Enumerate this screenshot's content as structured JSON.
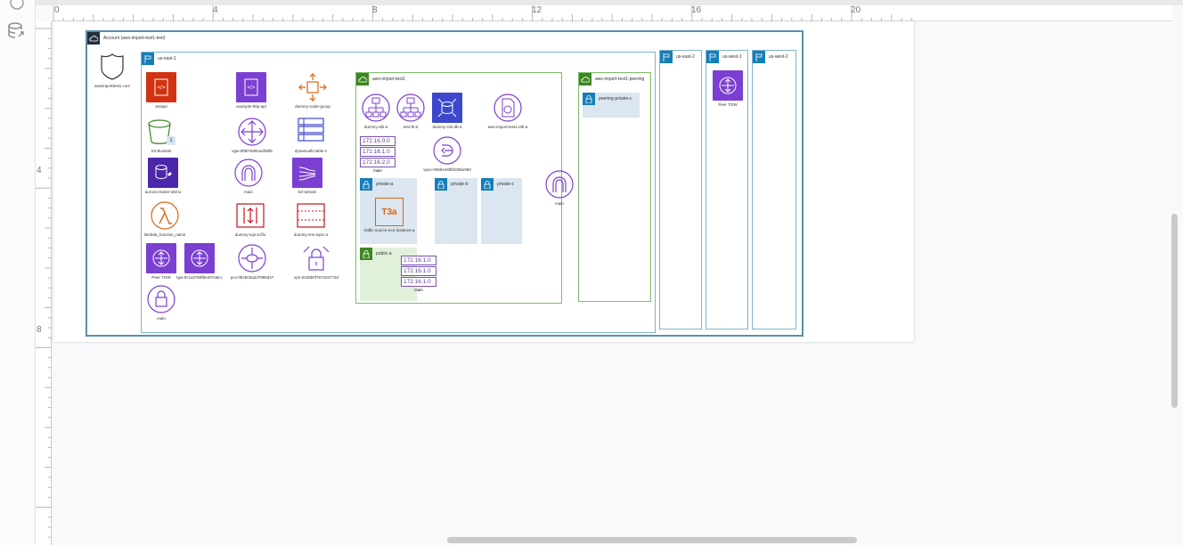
{
  "ruler": {
    "h_labels": [
      "0",
      "4",
      "8",
      "12",
      "16",
      "20"
    ],
    "v_labels": [
      "4",
      "8"
    ]
  },
  "left_toolbar": {
    "items": [
      "help-icon",
      "database-link-icon"
    ]
  },
  "account": {
    "label": "Account (aws-import-test1-test)"
  },
  "root_node": {
    "label": "awsimporttest1.com",
    "icon": "shield-icon"
  },
  "regions": {
    "main": "us-east-1",
    "r2": "us-east-2",
    "r3": "us-west-1",
    "r4": "us-west-2"
  },
  "region_nodes": {
    "apigw": "testapi",
    "http_api": "example-http-api",
    "asg": "dummy-scale-group",
    "s3": "S3 Buckets",
    "s3_badge": "1",
    "vgw": "vgw-0f9b76d9ca4f36f8",
    "dynamo": "dynamodb-table-1",
    "aurora": "aurora-cluster-demo",
    "igw": "main",
    "kinesis": "kcl-stream",
    "lambda": "lambda_function_name",
    "sqs": "dummy-sqs-a.fifo",
    "sns": "dummy-sns-topic-a",
    "tgw1": "Peer TGW",
    "tgw2": "tgw-0c1a27b8f0e407a6cc",
    "pcx": "pcx-0b4503a2d7985d47",
    "vpn": "vpn-0348b0f767334773d",
    "kms": "main"
  },
  "vpc_main": {
    "label": "aws-import-test1",
    "albs": [
      "dummy-alb-a",
      "test-lb-d"
    ],
    "rds": "dummy-rds-db-a",
    "elb": "aws-import-test1-elb-a",
    "cidrs": [
      "172.16.0.0",
      "172.16.1.0",
      "172.16.2.0"
    ],
    "cidr_caption": "main",
    "vpce": "vpce-00691e6f8f1835e993",
    "subnet_a": "private-a",
    "subnet_b": "private-b",
    "subnet_c": "private-c",
    "ec2_chip": "T3a",
    "ec2": "traffic-source-ec2-instance-a",
    "public_subnet": "public-a",
    "public_cidrs": [
      "172.16.1.0",
      "172.16.1.0",
      "172.16.1.0"
    ],
    "public_caption": "main",
    "router": "main"
  },
  "vpc_peering": {
    "label": "aws-import-test1-peering",
    "subnet": "peering-private-c"
  },
  "west1_node": "Peer TGW",
  "colors": {
    "purple": "#7b3fd1",
    "red": "#d13212",
    "green": "#3f8624",
    "orange": "#d86613",
    "blue": "#147eba",
    "lambda": "#d86613"
  }
}
